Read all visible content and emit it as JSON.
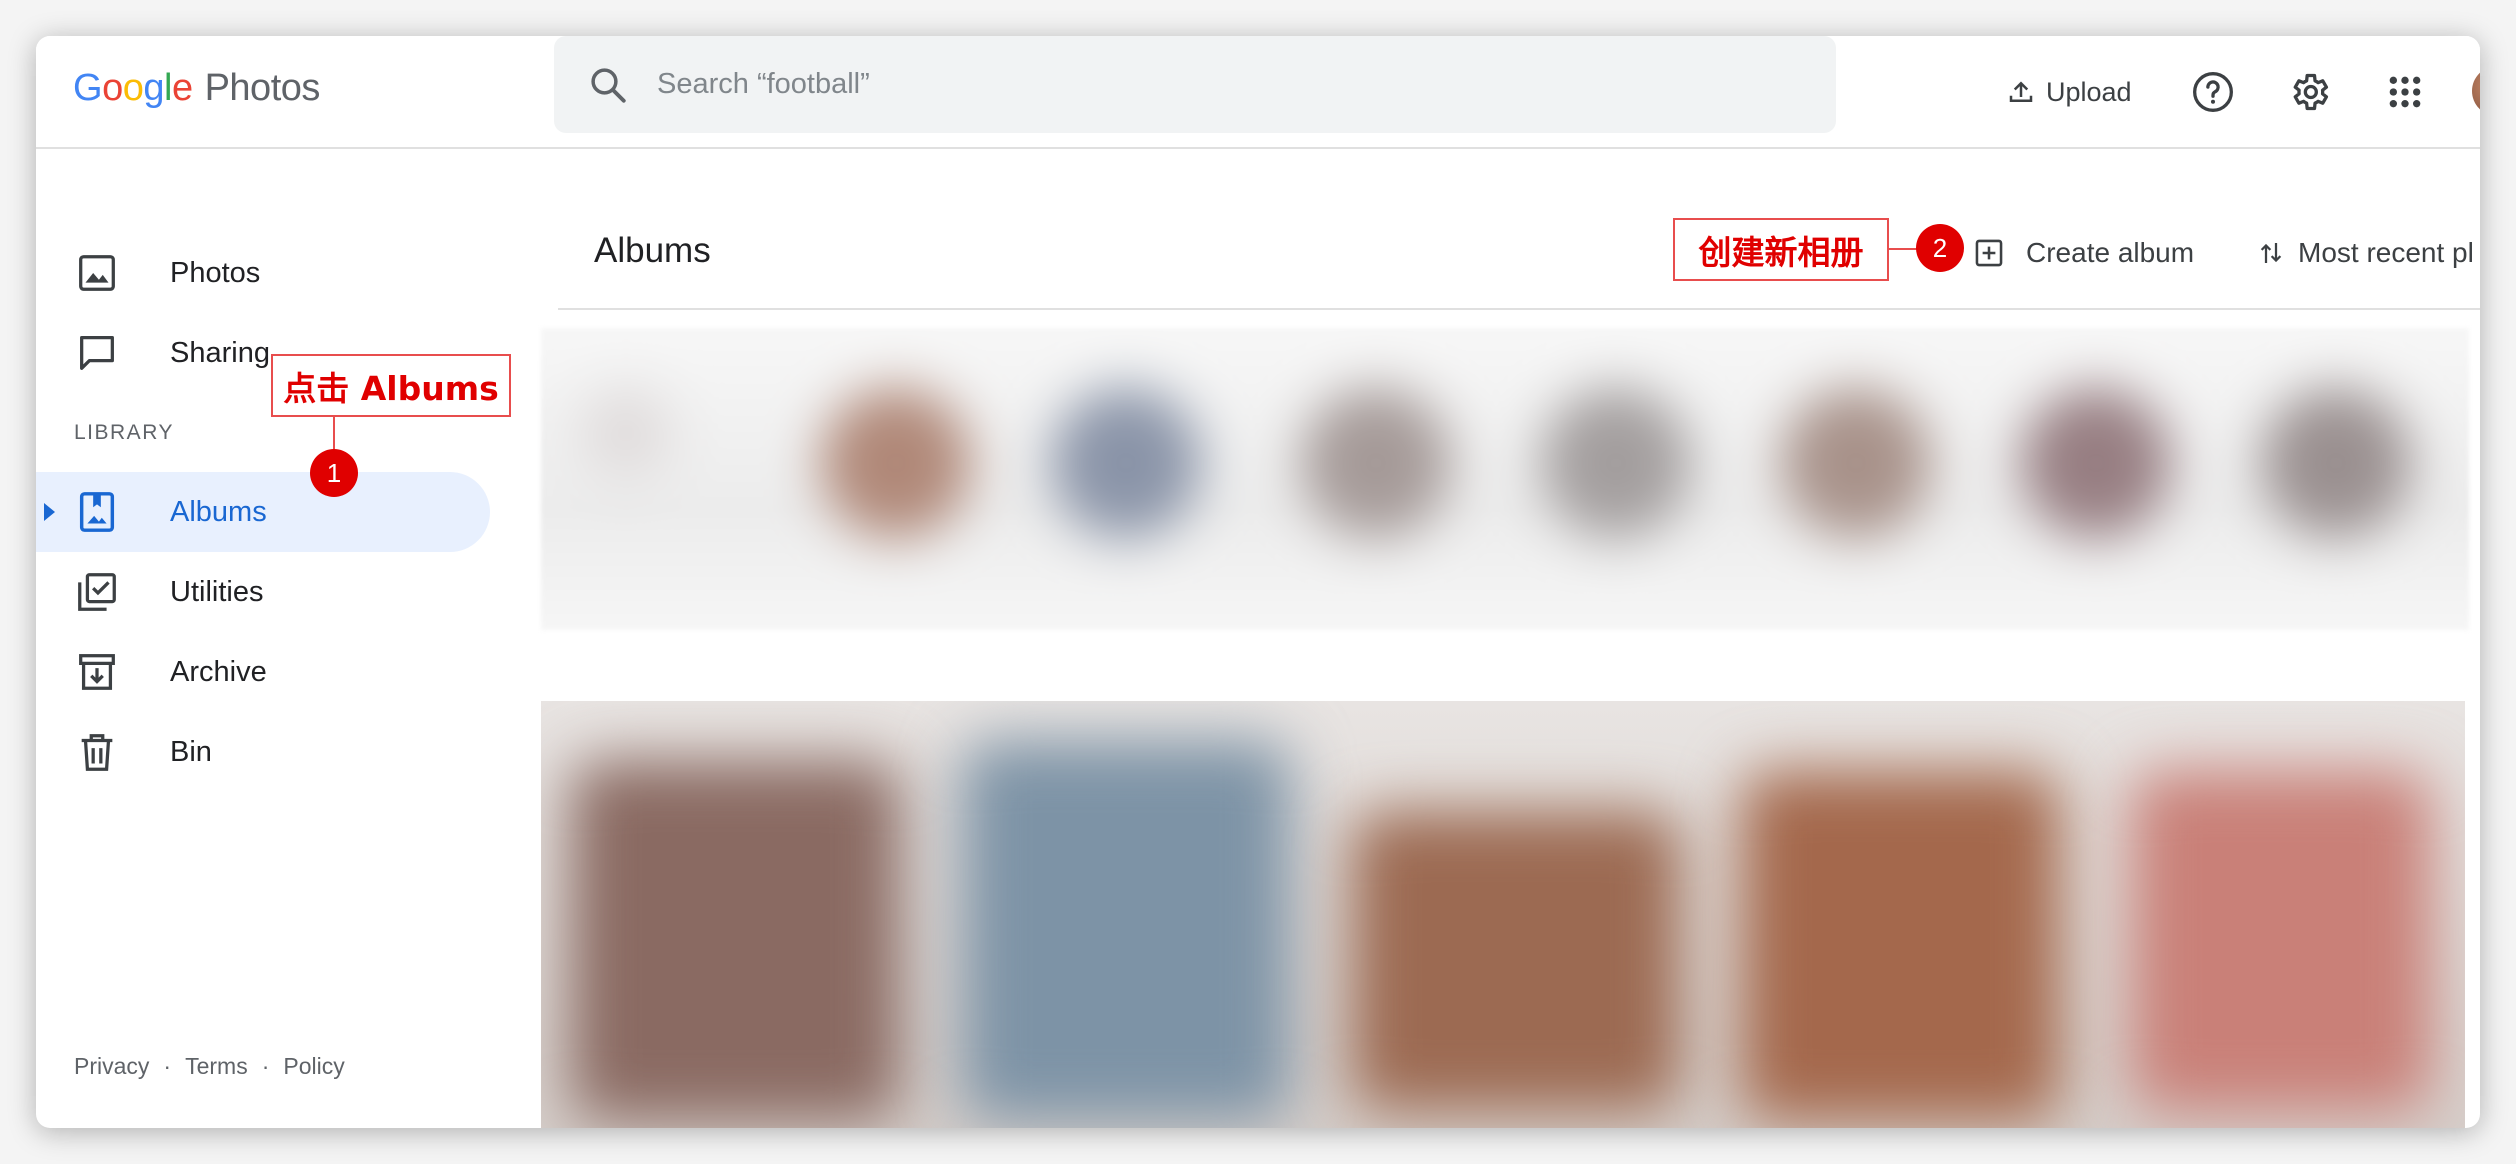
{
  "app": {
    "logo_letters": [
      "G",
      "o",
      "o",
      "g",
      "l",
      "e"
    ],
    "product": "Photos"
  },
  "search": {
    "placeholder": "Search “football”",
    "icon": "search-icon"
  },
  "header_actions": {
    "upload_label": "Upload",
    "help_icon": "help-icon",
    "settings_icon": "gear-icon",
    "apps_icon": "apps-grid-icon"
  },
  "sidebar": {
    "items": [
      {
        "label": "Photos",
        "icon": "photo-icon"
      },
      {
        "label": "Sharing",
        "icon": "chat-bubble-icon"
      }
    ],
    "section_label": "LIBRARY",
    "library_items": [
      {
        "label": "Albums",
        "icon": "album-icon",
        "active": true
      },
      {
        "label": "Utilities",
        "icon": "utilities-icon"
      },
      {
        "label": "Archive",
        "icon": "archive-icon"
      },
      {
        "label": "Bin",
        "icon": "trash-icon"
      }
    ],
    "footer": [
      "Privacy",
      "·",
      "Terms",
      "·",
      "Policy"
    ]
  },
  "main": {
    "title": "Albums",
    "create_album_label": "Create album",
    "sort_label": "Most recent pl"
  },
  "annotations": {
    "step1_label": "点击 Albums",
    "step1_number": "1",
    "step2_label": "创建新相册",
    "step2_number": "2"
  },
  "colors": {
    "google_blue": "#4285f4",
    "google_red": "#ea4335",
    "google_yellow": "#fbbc05",
    "google_green": "#34a853",
    "active_blue": "#1967d2",
    "annotation_red": "#e00000"
  }
}
